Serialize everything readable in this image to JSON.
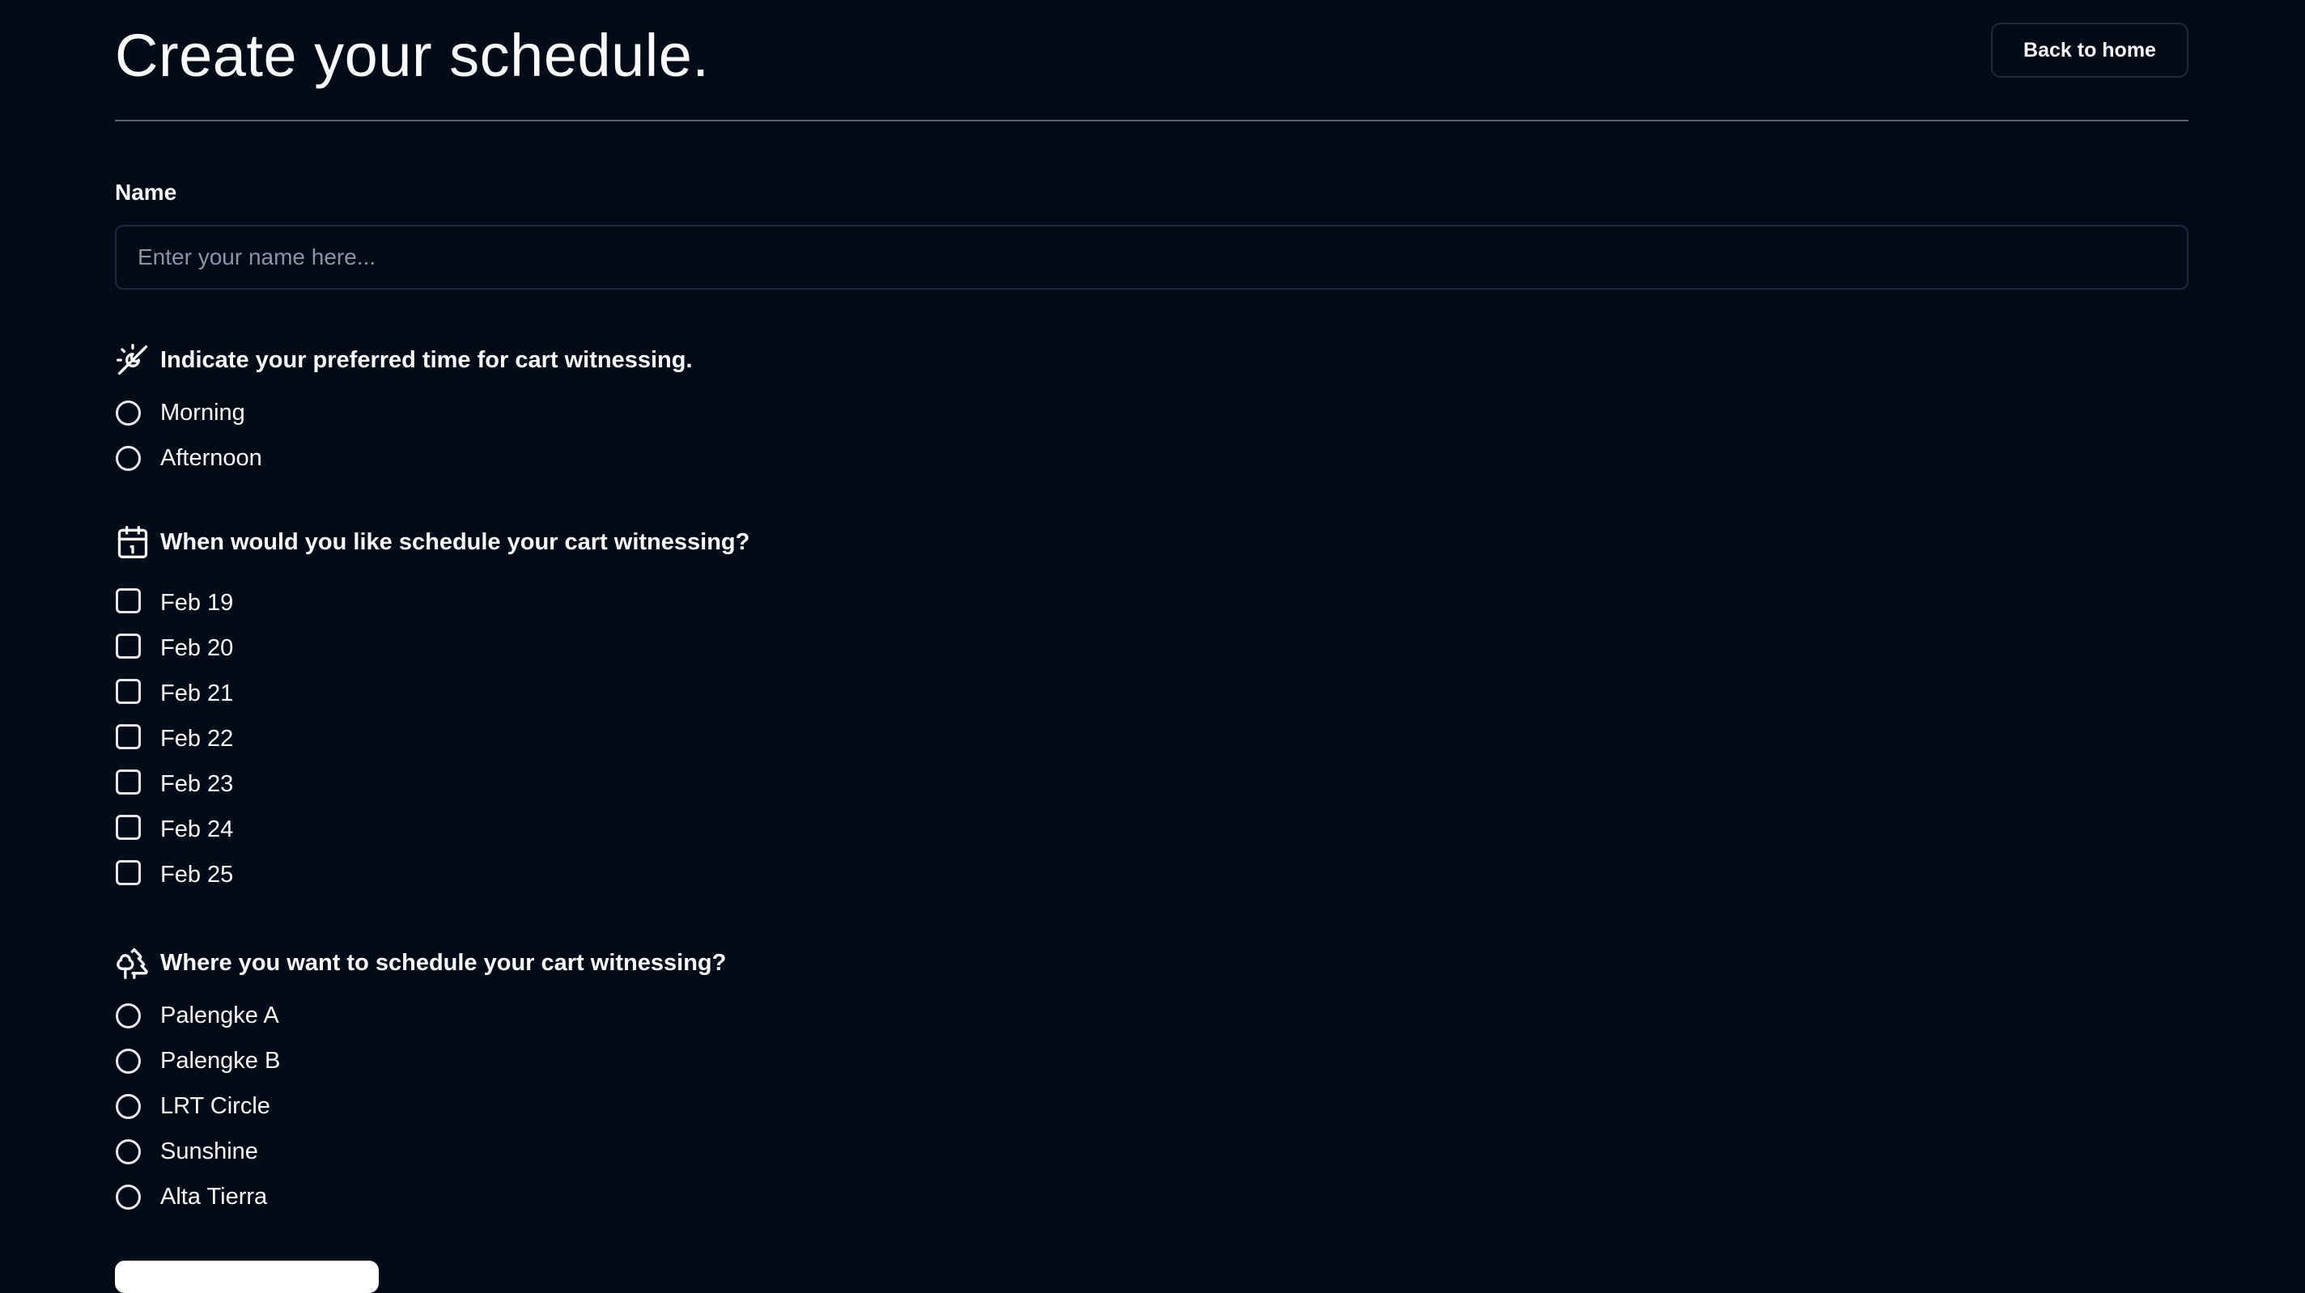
{
  "header": {
    "title": "Create your schedule.",
    "back_label": "Back to home"
  },
  "name_field": {
    "label": "Name",
    "placeholder": "Enter your name here...",
    "value": ""
  },
  "time_section": {
    "icon": "sun-moon-icon",
    "question": "Indicate your preferred time for cart witnessing.",
    "options": [
      "Morning",
      "Afternoon"
    ]
  },
  "date_section": {
    "icon": "calendar-icon",
    "question": "When would you like schedule your cart witnessing?",
    "options": [
      "Feb 19",
      "Feb 20",
      "Feb 21",
      "Feb 22",
      "Feb 23",
      "Feb 24",
      "Feb 25"
    ]
  },
  "location_section": {
    "icon": "trees-icon",
    "question": "Where you want to schedule your cart witnessing?",
    "options": [
      "Palengke A",
      "Palengke B",
      "LRT Circle",
      "Sunshine",
      "Alta Tierra"
    ]
  },
  "colors": {
    "background": "#030a18",
    "text": "#f8fafc",
    "border": "#1e293b"
  }
}
